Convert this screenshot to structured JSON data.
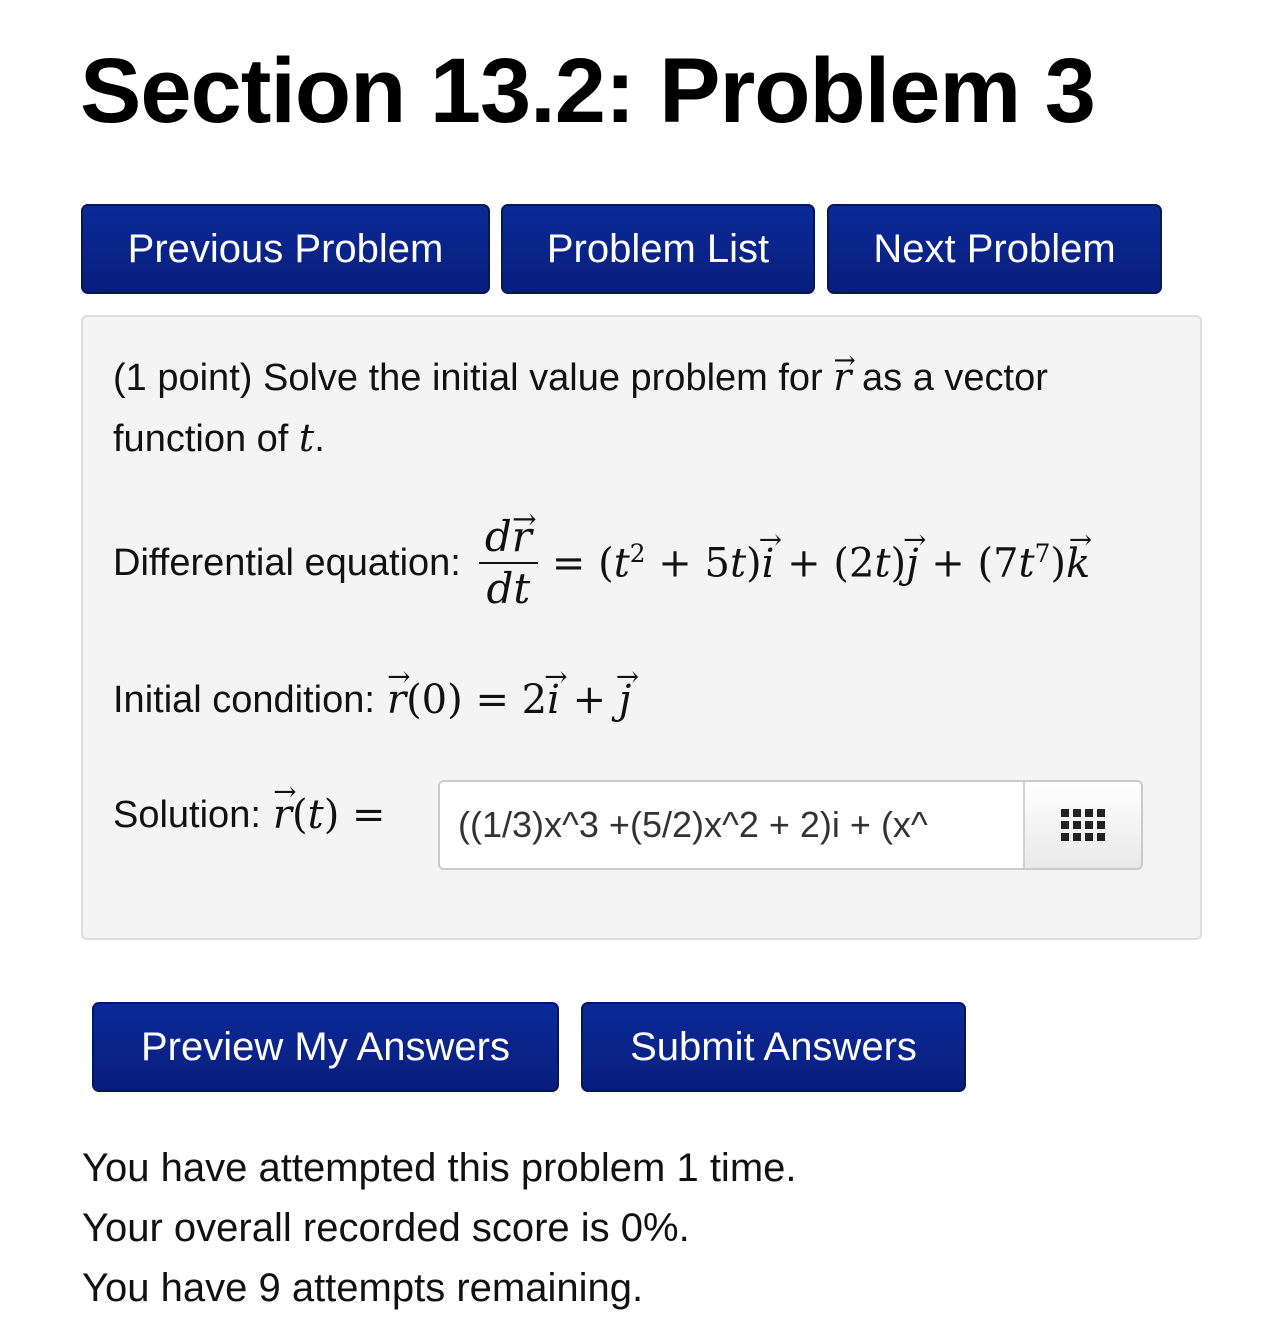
{
  "page": {
    "title": "Section 13.2: Problem 3"
  },
  "nav": {
    "previous": "Previous Problem",
    "list": "Problem List",
    "next": "Next Problem"
  },
  "problem": {
    "points": "(1 point)",
    "prompt_start": "Solve the initial value problem for",
    "prompt_mid": "as a vector function of",
    "prompt_end": ".",
    "var_r": "r",
    "var_t": "t",
    "diff_label": "Differential equation:",
    "init_label": "Initial condition:",
    "solution_label": "Solution:"
  },
  "answer": {
    "value": "((1/3)x^3 +(5/2)x^2 + 2)i + (x^"
  },
  "actions": {
    "preview": "Preview My Answers",
    "submit": "Submit Answers"
  },
  "status": {
    "attempts": "You have attempted this problem 1 time.",
    "score": "Your overall recorded score is 0%.",
    "remaining": "You have 9 attempts remaining."
  },
  "colors": {
    "button_bg": "#0b2a97",
    "panel_bg": "#f4f4f4"
  },
  "icons": {
    "equation_editor": "grid-icon"
  }
}
